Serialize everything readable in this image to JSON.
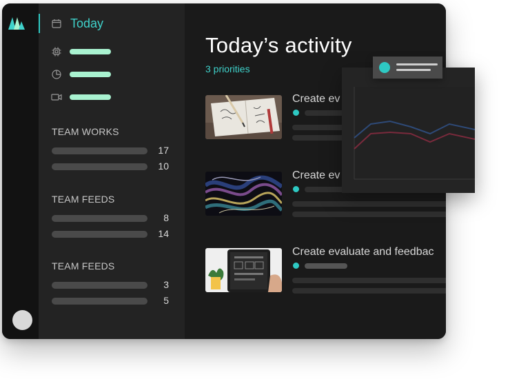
{
  "sidebar": {
    "today_label": "Today",
    "nav_icons": [
      "chip-icon",
      "pie-chart-icon",
      "video-icon"
    ],
    "sections": [
      {
        "title": "TEAM WORKS",
        "counts": [
          "17",
          "10"
        ]
      },
      {
        "title": "TEAM FEEDS",
        "counts": [
          "8",
          "14"
        ]
      },
      {
        "title": "TEAM FEEDS",
        "counts": [
          "3",
          "5"
        ]
      }
    ]
  },
  "main": {
    "title": "Today’s activity",
    "subtitle": "3 priorities",
    "cards": [
      {
        "title": "Create ev",
        "thumb": "sketchbook"
      },
      {
        "title": "Create ev",
        "thumb": "abstract-fluid"
      },
      {
        "title": "Create evaluate and feedbac",
        "thumb": "tablet-wireframe"
      }
    ]
  },
  "colors": {
    "accent": "#2ec9c3",
    "nav_pill": "#a9f2d0",
    "series_a": "#2e4a78",
    "series_b": "#7a2a3c"
  }
}
